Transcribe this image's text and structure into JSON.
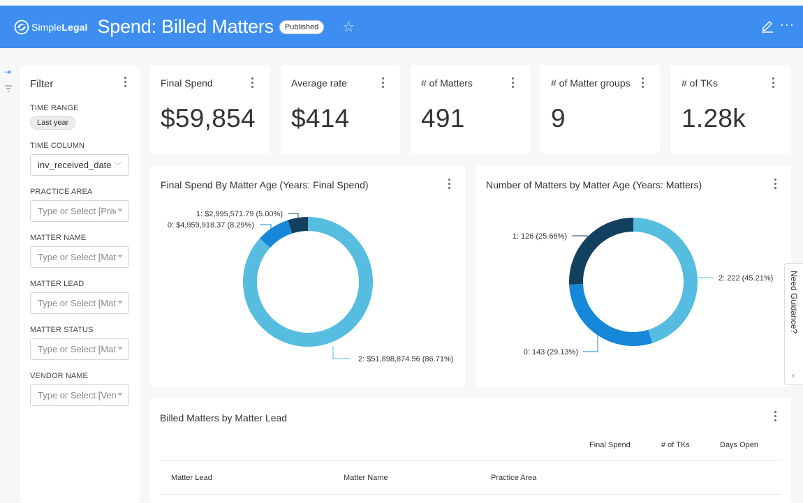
{
  "header": {
    "logo_brand_light": "Simple",
    "logo_brand_bold": "Legal",
    "title": "Spend: Billed Matters",
    "status_badge": "Published",
    "star_icon": "star-icon",
    "accent_color": "#3d8ef0"
  },
  "filter": {
    "title": "Filter",
    "fields": [
      {
        "label": "TIME RANGE",
        "value": "Last year"
      },
      {
        "label": "TIME COLUMN",
        "value": "inv_received_date"
      },
      {
        "label": "PRACTICE AREA",
        "placeholder": "Type or Select [Prac"
      },
      {
        "label": "MATTER NAME",
        "placeholder": "Type or Select [Mat"
      },
      {
        "label": "MATTER LEAD",
        "placeholder": "Type or Select [Mat"
      },
      {
        "label": "MATTER STATUS",
        "placeholder": "Type or Select [Mat"
      },
      {
        "label": "VENDOR NAME",
        "placeholder": "Type or Select [Ven"
      }
    ]
  },
  "kpis": [
    {
      "title": "Final Spend",
      "value": "$59,854"
    },
    {
      "title": "Average rate",
      "value": "$414"
    },
    {
      "title": "# of Matters",
      "value": "491"
    },
    {
      "title": "# of Matter groups",
      "value": "9"
    },
    {
      "title": "# of TKs",
      "value": "1.28k"
    }
  ],
  "chart_data": [
    {
      "type": "pie",
      "title": "Final Spend By Matter Age (Years: Final Spend)",
      "donut": true,
      "slices": [
        {
          "label": "2: $51,898,874.56 (86.71%)",
          "category": "2",
          "value": 51898874.56,
          "percent": 86.71,
          "color": "#56bde0"
        },
        {
          "label": "0: $4,959,918.37 (8.29%)",
          "category": "0",
          "value": 4959918.37,
          "percent": 8.29,
          "color": "#1687d9"
        },
        {
          "label": "1: $2,995,571.79 (5.00%)",
          "category": "1",
          "value": 2995571.79,
          "percent": 5.0,
          "color": "#13405f"
        }
      ]
    },
    {
      "type": "pie",
      "title": "Number of Matters by Matter Age (Years: Matters)",
      "donut": true,
      "slices": [
        {
          "label": "2: 222 (45.21%)",
          "category": "2",
          "value": 222,
          "percent": 45.21,
          "color": "#56bde0"
        },
        {
          "label": "0: 143 (29.13%)",
          "category": "0",
          "value": 143,
          "percent": 29.13,
          "color": "#1687d9"
        },
        {
          "label": "1: 126 (25.66%)",
          "category": "1",
          "value": 126,
          "percent": 25.66,
          "color": "#13405f"
        }
      ]
    }
  ],
  "table": {
    "title": "Billed Matters by Matter Lead",
    "metric_headers": [
      "Final Spend",
      "# of TKs",
      "Days Open"
    ],
    "group_headers": [
      "Matter Lead",
      "Matter Name",
      "Practice Area"
    ]
  },
  "guidance": {
    "label": "Need Guidance?"
  }
}
